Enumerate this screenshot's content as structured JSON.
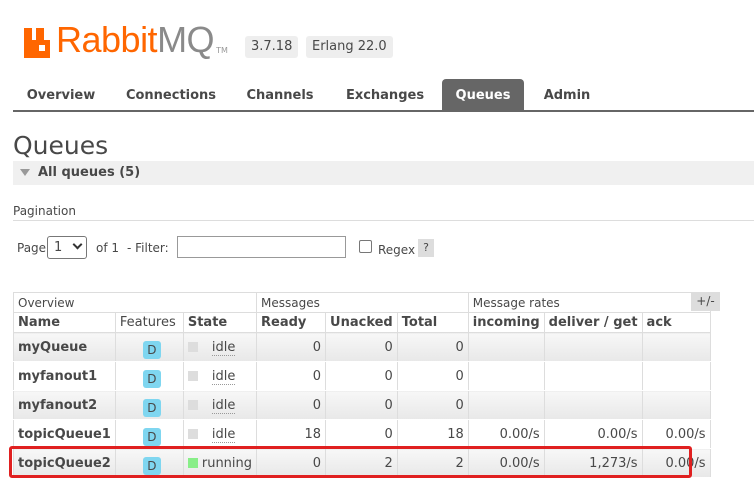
{
  "header": {
    "logo_part1": "Rabbit",
    "logo_part2": "MQ",
    "logo_tm": "TM",
    "version": "3.7.18",
    "erlang": "Erlang 22.0"
  },
  "nav": {
    "tabs": [
      {
        "label": "Overview",
        "active": false
      },
      {
        "label": "Connections",
        "active": false
      },
      {
        "label": "Channels",
        "active": false
      },
      {
        "label": "Exchanges",
        "active": false
      },
      {
        "label": "Queues",
        "active": true
      },
      {
        "label": "Admin",
        "active": false
      }
    ]
  },
  "page": {
    "title": "Queues",
    "section": "All queues (5)"
  },
  "pagination": {
    "label": "Pagination",
    "page_label": "Page",
    "page_value": "1",
    "of_label": "of 1",
    "filter_label": "- Filter:",
    "filter_value": "",
    "regex_label": "Regex",
    "help": "?"
  },
  "table": {
    "groups": [
      "Overview",
      "Messages",
      "Message rates"
    ],
    "plus_minus": "+/-",
    "columns": [
      "Name",
      "Features",
      "State",
      "Ready",
      "Unacked",
      "Total",
      "incoming",
      "deliver / get",
      "ack"
    ],
    "rows": [
      {
        "name": "myQueue",
        "feature": "D",
        "state": "idle",
        "ready": "0",
        "unacked": "0",
        "total": "0",
        "incoming": "",
        "deliver": "",
        "ack": ""
      },
      {
        "name": "myfanout1",
        "feature": "D",
        "state": "idle",
        "ready": "0",
        "unacked": "0",
        "total": "0",
        "incoming": "",
        "deliver": "",
        "ack": ""
      },
      {
        "name": "myfanout2",
        "feature": "D",
        "state": "idle",
        "ready": "0",
        "unacked": "0",
        "total": "0",
        "incoming": "",
        "deliver": "",
        "ack": ""
      },
      {
        "name": "topicQueue1",
        "feature": "D",
        "state": "idle",
        "ready": "18",
        "unacked": "0",
        "total": "18",
        "incoming": "0.00/s",
        "deliver": "0.00/s",
        "ack": "0.00/s"
      },
      {
        "name": "topicQueue2",
        "feature": "D",
        "state": "running",
        "ready": "0",
        "unacked": "2",
        "total": "2",
        "incoming": "0.00/s",
        "deliver": "1,273/s",
        "ack": "0.00/s"
      }
    ]
  },
  "colors": {
    "brand": "#ff6600",
    "nav_active": "#666666",
    "highlight": "#e02020",
    "running": "#88ee88",
    "feature": "#7fd6f0"
  }
}
